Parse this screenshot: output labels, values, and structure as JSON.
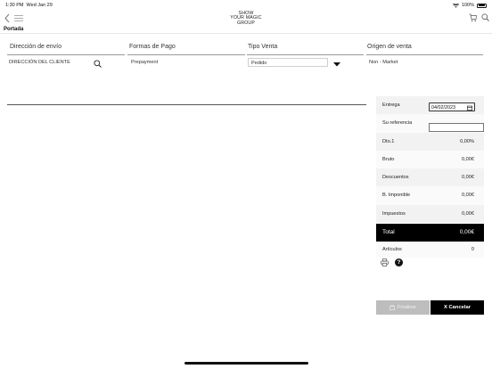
{
  "status_bar": {
    "time": "1:30 PM",
    "date": "Wed Jan 29",
    "battery": "100%"
  },
  "nav": {
    "logo_lines": [
      "SHOW",
      "YOUR MAGIC",
      "GROUP"
    ]
  },
  "breadcrumb": "Portada",
  "columns": {
    "shipping": {
      "header": "Dirección de envío",
      "value": "DIRECCIÓN DEL CLIENTE"
    },
    "payment": {
      "header": "Formas de Pago",
      "value": "Prepayment"
    },
    "sale_type": {
      "header": "Tipo Venta",
      "value": "Pedido"
    },
    "origin": {
      "header": "Origen de venta",
      "value": "Non - Market"
    }
  },
  "summary": {
    "delivery_label": "Entrega",
    "delivery_date": "04/02/2023",
    "reference_label": "Su referencia",
    "reference_value": "",
    "rows": [
      {
        "label": "Dto.1",
        "value": "0,00%"
      },
      {
        "label": "Bruto",
        "value": "0,00€"
      },
      {
        "label": "Descuentos",
        "value": "0,00€"
      },
      {
        "label": "B. Imponible",
        "value": "0,00€"
      },
      {
        "label": "Impuestos",
        "value": "0,00€"
      }
    ],
    "total_label": "Total",
    "total_value": "0,00€",
    "articles_label": "Artículos",
    "articles_value": "0"
  },
  "actions": {
    "finalize_label": "Finalizar",
    "cancel_label": "X Cancelar"
  },
  "icons": [
    "wifi-icon",
    "battery-icon",
    "back-icon",
    "menu-icon",
    "cart-icon",
    "search-icon",
    "caret-down-icon",
    "calendar-icon",
    "print-icon",
    "help-icon",
    "bag-icon"
  ]
}
